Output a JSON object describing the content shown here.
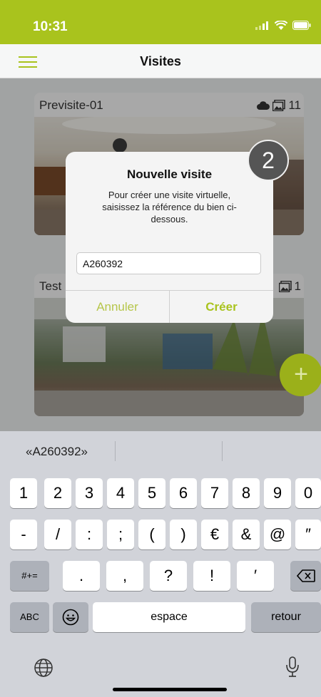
{
  "status": {
    "time": "10:31"
  },
  "nav": {
    "title": "Visites"
  },
  "cards": [
    {
      "title": "Previsite-01",
      "count": "11"
    },
    {
      "title": "Test",
      "count": "1"
    }
  ],
  "fab": {
    "label": "+"
  },
  "step_badge": "2",
  "dialog": {
    "title": "Nouvelle visite",
    "message": "Pour créer une visite virtuelle, saisissez la référence du bien ci-dessous.",
    "input_value": "A260392",
    "cancel_label": "Annuler",
    "create_label": "Créer"
  },
  "keyboard": {
    "suggestion": "«A260392»",
    "row1": [
      "1",
      "2",
      "3",
      "4",
      "5",
      "6",
      "7",
      "8",
      "9",
      "0"
    ],
    "row2": [
      "-",
      "/",
      ":",
      ";",
      "(",
      ")",
      "€",
      "&",
      "@",
      "″"
    ],
    "row3_mode": "#+=",
    "row3": [
      ".",
      ",",
      "?",
      "!",
      "′"
    ],
    "abc_label": "ABC",
    "space_label": "espace",
    "return_label": "retour"
  },
  "colors": {
    "accent": "#a9c31d",
    "fab": "#9bb01a"
  }
}
